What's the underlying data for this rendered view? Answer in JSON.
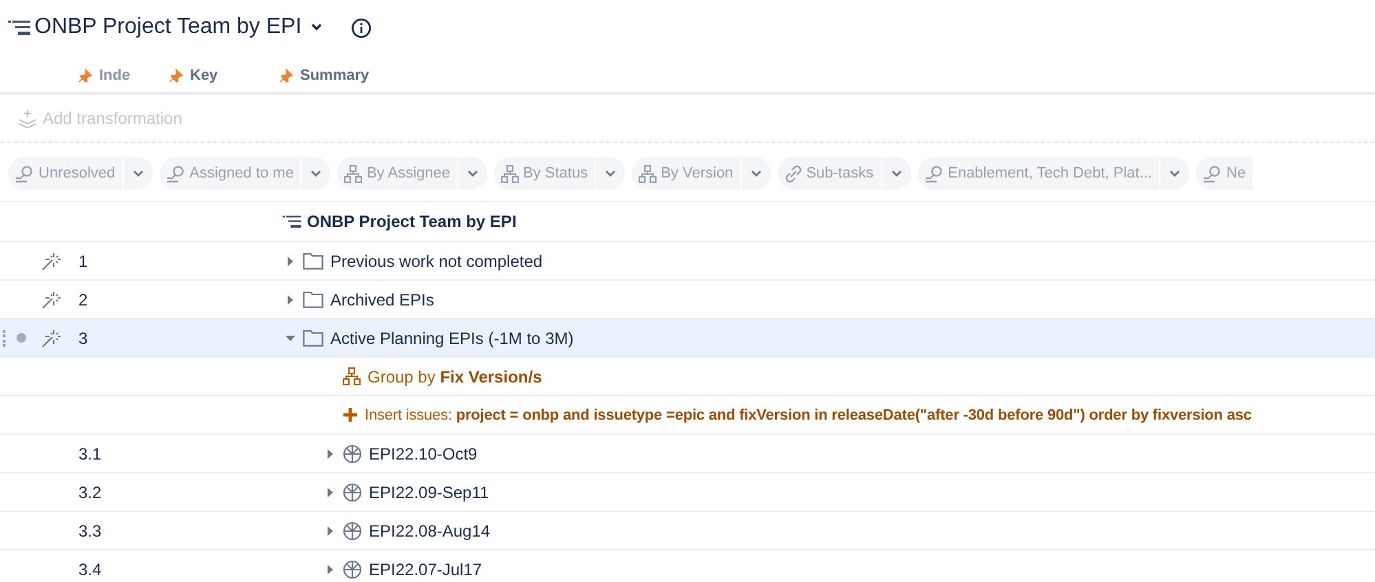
{
  "title": "ONBP Project Team by EPI",
  "columns": [
    {
      "label": "Inde",
      "pinned": true
    },
    {
      "label": "Key",
      "pinned": true
    },
    {
      "label": "Summary",
      "pinned": true
    }
  ],
  "add_transformation": "Add transformation",
  "filters": [
    {
      "label": "Unresolved",
      "kind": "search"
    },
    {
      "label": "Assigned to me",
      "kind": "search"
    },
    {
      "label": "By Assignee",
      "kind": "group"
    },
    {
      "label": "By Status",
      "kind": "group"
    },
    {
      "label": "By Version",
      "kind": "group"
    },
    {
      "label": "Sub-tasks",
      "kind": "link"
    },
    {
      "label": "Enablement, Tech Debt, Plat...",
      "kind": "search"
    },
    {
      "label": "Ne",
      "kind": "search"
    }
  ],
  "tree": {
    "title": "ONBP Project Team by EPI",
    "rows": [
      {
        "kind": "folder",
        "index": "1",
        "text": "Previous work not completed",
        "expanded": false,
        "selected": false
      },
      {
        "kind": "folder",
        "index": "2",
        "text": "Archived EPIs",
        "expanded": false,
        "selected": false
      },
      {
        "kind": "folder",
        "index": "3",
        "text": "Active Planning EPIs (-1M to 3M)",
        "expanded": true,
        "selected": true,
        "children": [
          {
            "kind": "group_by",
            "text": "Group by **Fix Version/s**"
          },
          {
            "kind": "insert",
            "text": "Insert issues: **project = onbp and issuetype =epic and fixVersion in releaseDate(\"after -30d before 90d\") order by fixversion asc**"
          },
          {
            "kind": "version",
            "index": "3.1",
            "text": "EPI22.10-Oct9",
            "expanded": false,
            "selected": false
          },
          {
            "kind": "version",
            "index": "3.2",
            "text": "EPI22.09-Sep11",
            "expanded": false,
            "selected": false
          },
          {
            "kind": "version",
            "index": "3.3",
            "text": "EPI22.08-Aug14",
            "expanded": false,
            "selected": false
          },
          {
            "kind": "version",
            "index": "3.4",
            "text": "EPI22.07-Jul17",
            "expanded": false,
            "selected": false
          }
        ]
      }
    ]
  }
}
